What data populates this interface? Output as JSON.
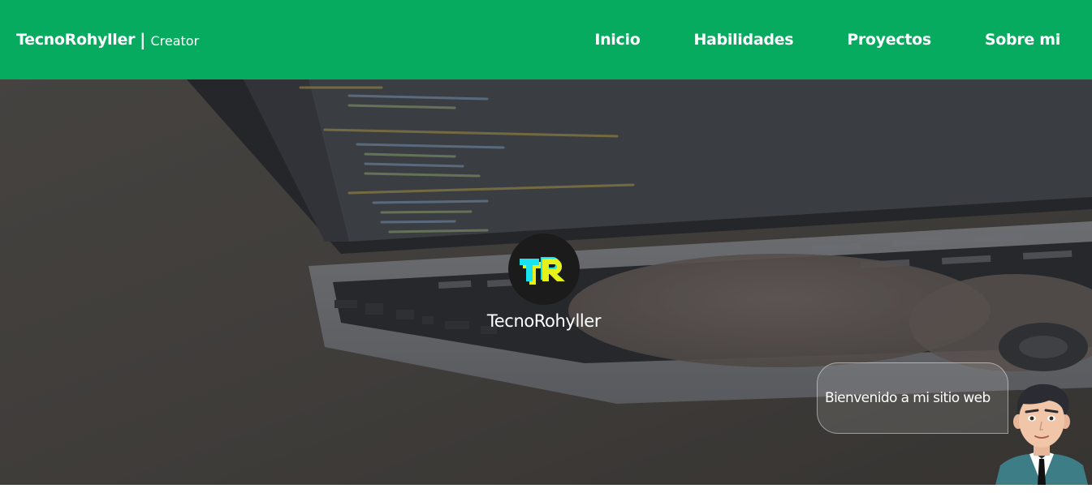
{
  "header": {
    "brand_name": "TecnoRohyller",
    "brand_separator": "|",
    "brand_role": "Creator",
    "nav": [
      {
        "label": "Inicio"
      },
      {
        "label": "Habilidades"
      },
      {
        "label": "Proyectos"
      },
      {
        "label": "Sobre mi"
      }
    ]
  },
  "hero": {
    "logo_text": "TR",
    "name": "TecnoRohyller",
    "greeting": "Bienvenido a mi sitio web",
    "background_icon": "laptop-code-photo",
    "avatar_icon": "cartoon-man-avatar"
  },
  "colors": {
    "header_bg": "#06ab5f",
    "logo_cyan": "#19e3f0",
    "logo_yellow": "#e8f01a"
  }
}
